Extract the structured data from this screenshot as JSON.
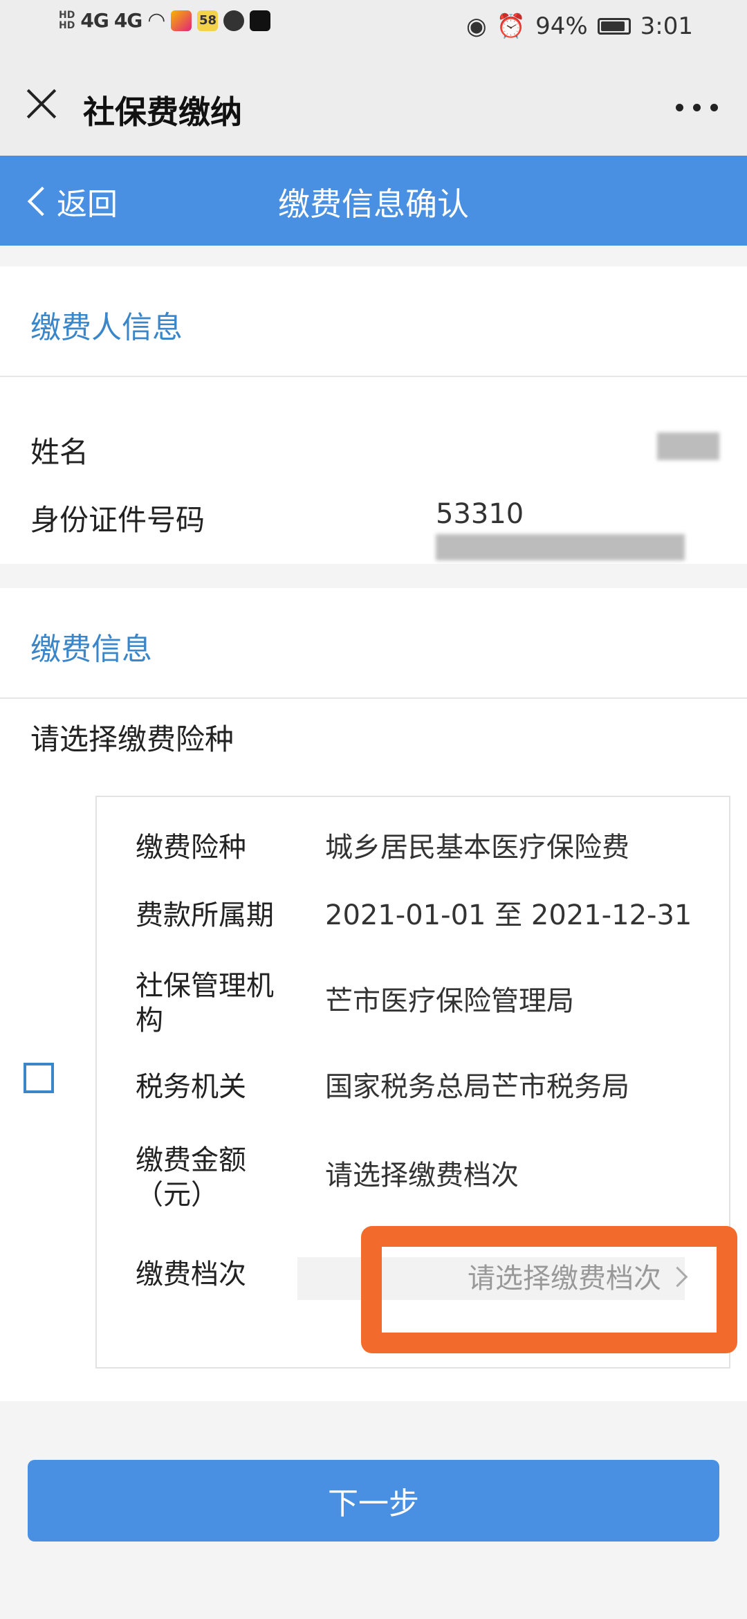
{
  "status_bar": {
    "time": "3:01",
    "battery": "94%",
    "network_left": "4G",
    "network_right": "4G",
    "app_badge": "58",
    "icons": [
      "hd-icon",
      "signal-icon",
      "wifi-icon",
      "video-app-icon",
      "58-app-icon",
      "browser-app-icon",
      "tiktok-icon",
      "eye-icon",
      "alarm-icon",
      "battery-icon"
    ]
  },
  "title_bar": {
    "title": "社保费缴纳"
  },
  "nav": {
    "back_label": "返回",
    "title": "缴费信息确认"
  },
  "payer_section": {
    "title": "缴费人信息",
    "name_label": "姓名",
    "id_label": "身份证件号码",
    "id_value_prefix": "53310"
  },
  "payment_section": {
    "title": "缴费信息",
    "prompt": "请选择缴费险种",
    "items": {
      "insurance_type_label": "缴费险种",
      "insurance_type_value": "城乡居民基本医疗保险费",
      "period_label": "费款所属期",
      "period_value": "2021-01-01 至 2021-12-31",
      "agency_label": "社保管理机构",
      "agency_value": "芒市医疗保险管理局",
      "tax_label": "税务机关",
      "tax_value": "国家税务总局芒市税务局",
      "amount_label": "缴费金额（元）",
      "amount_value": "请选择缴费档次",
      "tier_label": "缴费档次",
      "tier_placeholder": "请选择缴费档次"
    }
  },
  "footer": {
    "next_label": "下一步"
  },
  "colors": {
    "primary": "#4a90e2",
    "section_title": "#3a86c8",
    "highlight": "#f26b2c"
  }
}
